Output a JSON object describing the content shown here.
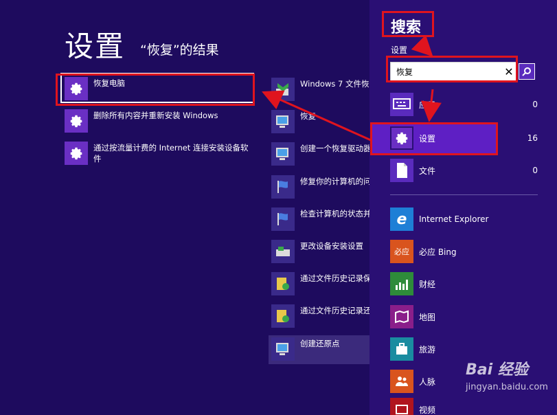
{
  "page": {
    "title": "设置",
    "subtitle": "“恢复”的结果"
  },
  "results_left": [
    {
      "label": "恢复电脑"
    },
    {
      "label": "删除所有内容并重新安装 Windows"
    },
    {
      "label": "通过按流量计费的 Internet 连接安装设备软件"
    }
  ],
  "results_right": [
    {
      "label": "Windows 7 文件恢"
    },
    {
      "label": "恢复"
    },
    {
      "label": "创建一个恢复驱动器"
    },
    {
      "label": "修复你的计算机的问"
    },
    {
      "label": "检查计算机的状态并"
    },
    {
      "label": "更改设备安装设置"
    },
    {
      "label": "通过文件历史记录保"
    },
    {
      "label": "通过文件历史记录还"
    },
    {
      "label": "创建还原点"
    }
  ],
  "search": {
    "title": "搜索",
    "scope": "设置",
    "query": "恢复",
    "clear_symbol": "✕"
  },
  "categories": [
    {
      "name": "应用",
      "count": "0"
    },
    {
      "name": "设置",
      "count": "16"
    },
    {
      "name": "文件",
      "count": "0"
    }
  ],
  "apps": [
    {
      "name": "Internet Explorer",
      "icon": "ie-icon",
      "color": "#1e7fd6"
    },
    {
      "name": "必应 Bing",
      "icon": "bing-icon",
      "color": "#d9541e",
      "tile_text": "必应"
    },
    {
      "name": "财经",
      "icon": "finance-icon",
      "color": "#2e8b3a"
    },
    {
      "name": "地图",
      "icon": "maps-icon",
      "color": "#8a1e8a"
    },
    {
      "name": "旅游",
      "icon": "travel-icon",
      "color": "#1a8ca0"
    },
    {
      "name": "人脉",
      "icon": "people-icon",
      "color": "#d9541e"
    },
    {
      "name": "视频",
      "icon": "video-icon",
      "color": "#b0141e"
    }
  ],
  "watermark": {
    "brand": "Bai 经验",
    "url": "jingyan.baidu.com"
  },
  "colors": {
    "background": "#1e0b5e",
    "search_pane": "#2a0f74",
    "accent": "#6a2fc4",
    "selected_category": "#5e1fc4",
    "annotation_red": "#e0141e"
  }
}
